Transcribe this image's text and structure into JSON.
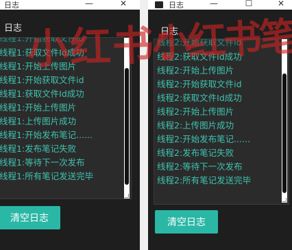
{
  "left_window": {
    "title": "日志",
    "section_label": "日志",
    "logs": [
      "线程1:开始获取文件id",
      "线程1:获取文件Id成功",
      "线程1:开始上传图片",
      "线程1:开始获取文件id",
      "线程1:获取文件Id成功",
      "线程1:开始上传图片",
      "线程1:上传图片成功",
      "线程1:开始发布笔记......",
      "线程1:发布笔记失败",
      "线程1:等待下一次发布",
      "线程1:所有笔记发送完毕"
    ],
    "clear_button": "清空日志"
  },
  "right_window": {
    "title": "日志",
    "section_label": "日志",
    "logs": [
      "线程2:开始获取文件id",
      "线程2:获取文件Id成功",
      "线程2:开始上传图片",
      "线程2:开始获取文件id",
      "线程2:获取文件Id成功",
      "线程2:开始上传图片",
      "线程2:上传图片成功",
      "线程2:开始发布笔记......",
      "线程2:发布笔记失败",
      "线程2:等待下一次发布",
      "线程2:所有笔记发送完毕"
    ],
    "clear_button": "清空日志"
  },
  "window_controls": {
    "minimize": "—",
    "maximize": "☐",
    "close": "✕"
  },
  "watermark": {
    "left": "小红书：",
    "right": "小红书笔记"
  },
  "colors": {
    "log_text": "#3ec3b0",
    "button": "#2bb7a6",
    "background": "#1e1e1e",
    "watermark": "#cd2323"
  }
}
